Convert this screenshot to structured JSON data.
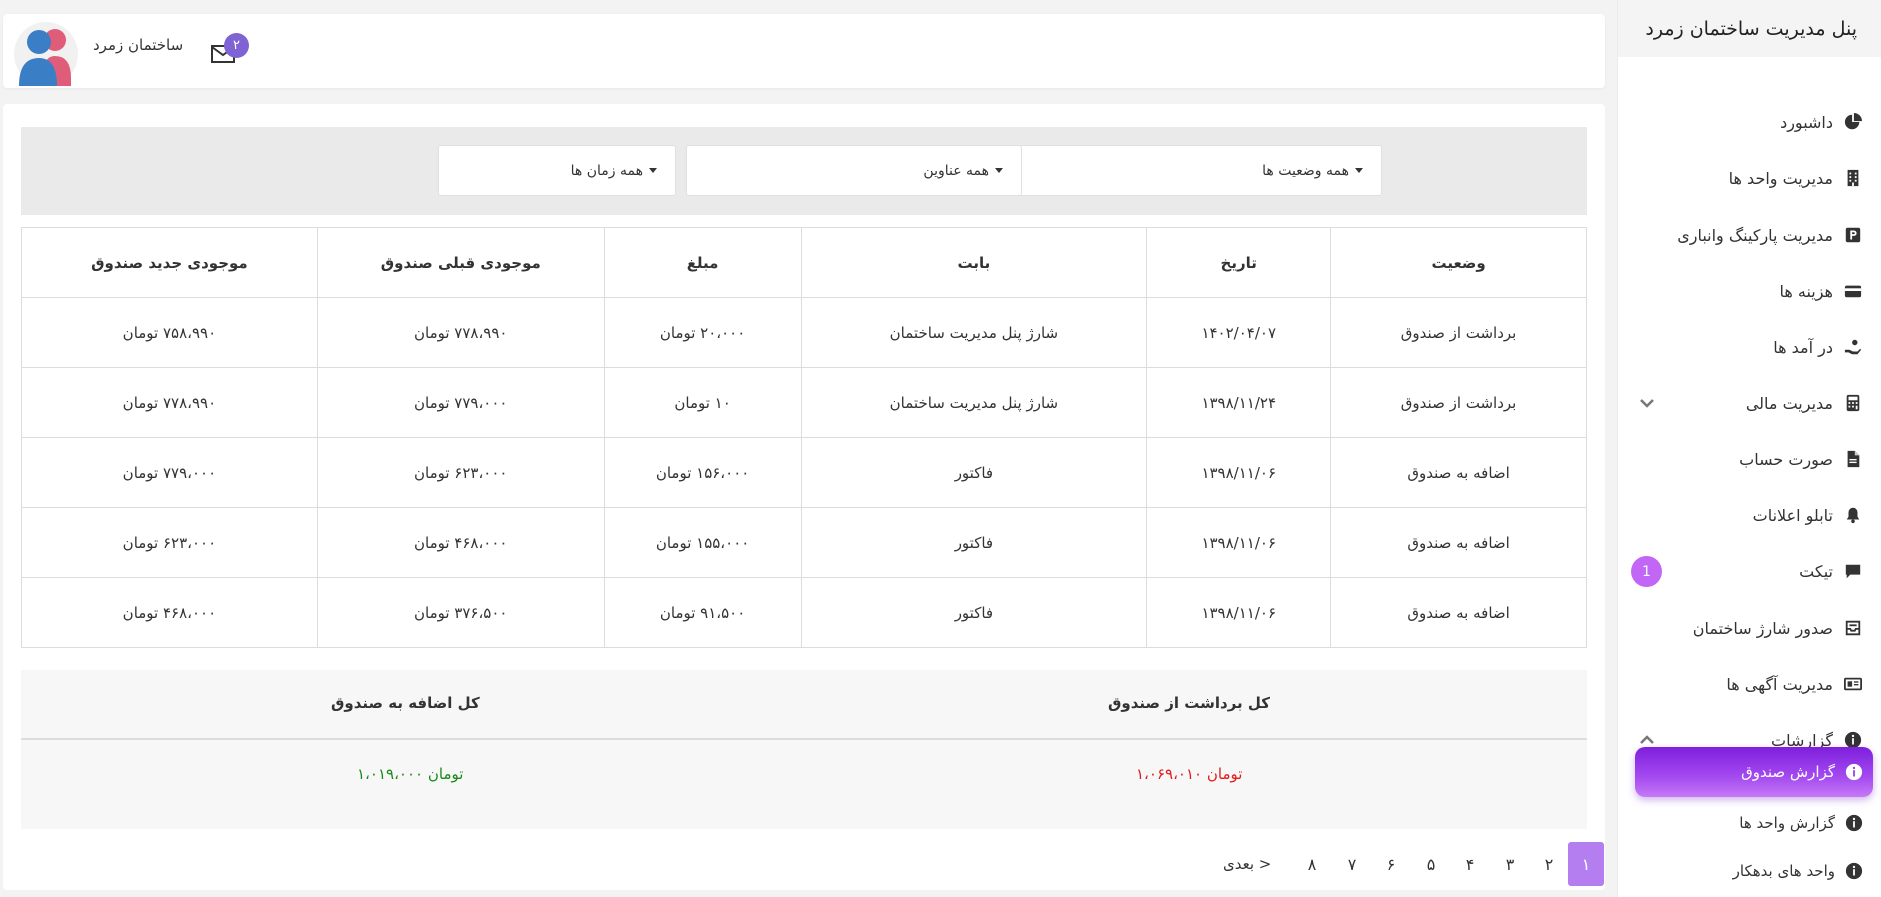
{
  "sidebar": {
    "title": "پنل مدیریت ساختمان زمرد",
    "items": [
      {
        "label": "داشبورد",
        "icon": "pie-chart-icon"
      },
      {
        "label": "مدیریت واحد ها",
        "icon": "building-icon"
      },
      {
        "label": "مدیریت پارکینگ وانباری",
        "icon": "parking-icon"
      },
      {
        "label": "هزینه ها",
        "icon": "credit-card-icon"
      },
      {
        "label": "در آمد ها",
        "icon": "hand-coin-icon"
      },
      {
        "label": "مدیریت مالی",
        "icon": "calculator-icon"
      },
      {
        "label": "صورت حساب",
        "icon": "document-icon"
      },
      {
        "label": "تابلو اعلانات",
        "icon": "bell-icon"
      },
      {
        "label": "تیکت",
        "icon": "chat-icon",
        "badge": "1"
      },
      {
        "label": "صدور شارژ ساختمان",
        "icon": "inbox-icon"
      },
      {
        "label": "مدیریت آگهی ها",
        "icon": "newspaper-icon"
      },
      {
        "label": "گزارشات",
        "icon": "info-icon"
      }
    ],
    "sub_items": [
      {
        "label": "گزارش صندوق",
        "icon": "info-icon"
      },
      {
        "label": "گزارش واحد ها",
        "icon": "info-icon"
      },
      {
        "label": "واحد های بدهکار",
        "icon": "info-icon"
      }
    ]
  },
  "header": {
    "user_name": "ساختمان زمرد",
    "mail_count": "۲"
  },
  "filters": {
    "status": "همه وضعیت ها",
    "titles": "همه عناوین",
    "times": "همه زمان ها"
  },
  "table": {
    "headers": {
      "status": "وضعیت",
      "date": "تاریخ",
      "subject": "بابت",
      "amount": "مبلغ",
      "prev_balance": "موجودی قبلی صندوق",
      "new_balance": "موجودی جدید صندوق"
    },
    "rows": [
      {
        "status": "برداشت از صندوق",
        "date": "۱۴۰۲/۰۴/۰۷",
        "subject": "شارژ پنل مدیریت ساختمان",
        "amount": "۲۰،۰۰۰ تومان",
        "prev": "۷۷۸،۹۹۰ تومان",
        "new": "۷۵۸،۹۹۰ تومان"
      },
      {
        "status": "برداشت از صندوق",
        "date": "۱۳۹۸/۱۱/۲۴",
        "subject": "شارژ پنل مدیریت ساختمان",
        "amount": "۱۰ تومان",
        "prev": "۷۷۹،۰۰۰ تومان",
        "new": "۷۷۸،۹۹۰ تومان"
      },
      {
        "status": "اضافه به صندوق",
        "date": "۱۳۹۸/۱۱/۰۶",
        "subject": "فاکتور",
        "amount": "۱۵۶،۰۰۰ تومان",
        "prev": "۶۲۳،۰۰۰ تومان",
        "new": "۷۷۹،۰۰۰ تومان"
      },
      {
        "status": "اضافه به صندوق",
        "date": "۱۳۹۸/۱۱/۰۶",
        "subject": "فاکتور",
        "amount": "۱۵۵،۰۰۰ تومان",
        "prev": "۴۶۸،۰۰۰ تومان",
        "new": "۶۲۳،۰۰۰ تومان"
      },
      {
        "status": "اضافه به صندوق",
        "date": "۱۳۹۸/۱۱/۰۶",
        "subject": "فاکتور",
        "amount": "۹۱،۵۰۰ تومان",
        "prev": "۳۷۶،۵۰۰ تومان",
        "new": "۴۶۸،۰۰۰ تومان"
      }
    ]
  },
  "totals": {
    "withdraw_label": "کل برداشت از صندوق",
    "deposit_label": "کل اضافه به صندوق",
    "withdraw_value": "۱،۰۶۹،۰۱۰ تومان",
    "deposit_value": "۱،۰۱۹،۰۰۰ تومان"
  },
  "pagination": {
    "pages": [
      "۱",
      "۲",
      "۳",
      "۴",
      "۵",
      "۶",
      "۷",
      "۸"
    ],
    "active": "۱",
    "next_label": "بعدی >"
  },
  "colors": {
    "accent": "#a44af0",
    "withdraw": "#e21c1c",
    "deposit": "#1a8a1a",
    "badge": "#c266f5"
  }
}
